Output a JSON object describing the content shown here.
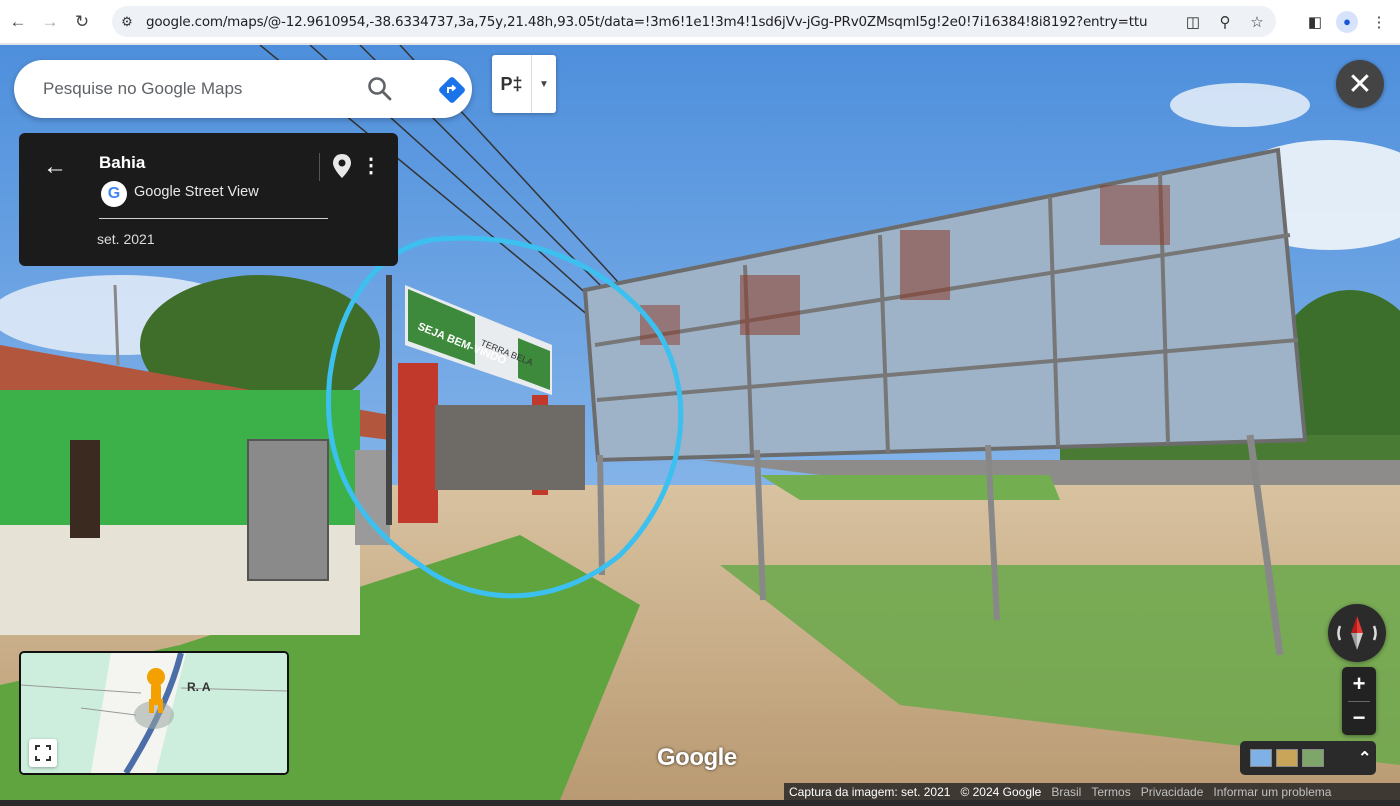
{
  "browser": {
    "url": "google.com/maps/@-12.9610954,-38.6334737,3a,75y,21.48h,93.05t/data=!3m6!1e1!3m4!1sd6jVv-jGg-PRv0ZMsqmI5g!2e0!7i16384!8i8192?entry=ttu",
    "icons": [
      "back-arrow-icon",
      "forward-arrow-icon",
      "reload-icon",
      "site-info-icon",
      "install-app-icon",
      "zoom-icon",
      "bookmark-star-icon",
      "side-panel-icon",
      "profile-icon",
      "menu-icon"
    ]
  },
  "search": {
    "placeholder": "Pesquise no Google Maps"
  },
  "pegman": {
    "label": "P‡"
  },
  "info_card": {
    "title": "Bahia",
    "source": "Google Street View",
    "date": "set. 2021"
  },
  "scene_text": {
    "sign_top": "SEJA BEM-VINDO",
    "sign_right": "TERRA BELA"
  },
  "minimap": {
    "road_label": "R. A"
  },
  "watermark": "Google",
  "footer": {
    "capture": "Captura da imagem: set. 2021",
    "copyright": "© 2024 Google",
    "country": "Brasil",
    "terms": "Termos",
    "privacy": "Privacidade",
    "report": "Informar um problema"
  },
  "colors": {
    "annotation_circle": "#3cc0ef",
    "sky": "#6aa6e6",
    "grass": "#6aa84a",
    "house_green": "#3cb14a"
  }
}
